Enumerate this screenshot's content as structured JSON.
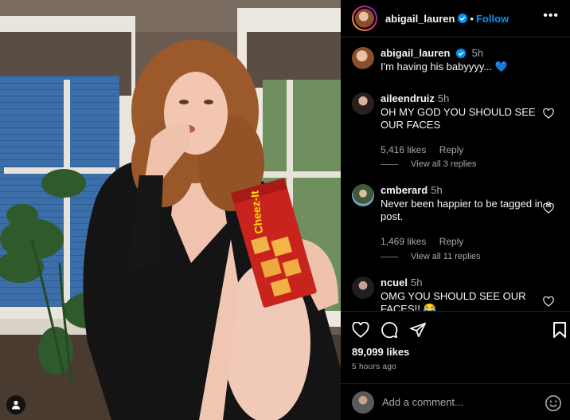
{
  "post": {
    "author": "abigail_lauren",
    "follow_label": "Follow",
    "separator": "•",
    "caption": {
      "username": "abigail_lauren",
      "time": "5h",
      "text": "I'm having his babyyyy... 💙"
    }
  },
  "comments": [
    {
      "username": "aileendruiz",
      "time": "5h",
      "text": "OH MY GOD YOU SHOULD SEE OUR FACES",
      "likes": "5,416 likes",
      "reply_label": "Reply",
      "view_replies": "View all 3 replies"
    },
    {
      "username": "cmberard",
      "time": "5h",
      "text": "Never been happier to be tagged in a post.",
      "likes": "1,469 likes",
      "reply_label": "Reply",
      "view_replies": "View all 11 replies"
    },
    {
      "username": "ncuel",
      "time": "5h",
      "text": "OMG YOU SHOULD SEE OUR FACES!! 😂"
    }
  ],
  "stats": {
    "likes": "89,099 likes",
    "time_ago": "5 hours ago"
  },
  "add_comment": {
    "placeholder": "Add a comment..."
  },
  "photo": {
    "box_brand": "Cheez-It"
  },
  "icons": {
    "like": "heart-icon",
    "comment": "comment-icon",
    "share": "share-icon",
    "save": "bookmark-icon",
    "more": "more-icon",
    "emoji": "emoji-icon",
    "verified": "verified-badge-icon",
    "tag": "user-tag-icon"
  },
  "colors": {
    "accent": "#0095f6",
    "background": "#000000",
    "secondary_text": "#a8a8a8",
    "caption_heart": "#3897f0"
  }
}
